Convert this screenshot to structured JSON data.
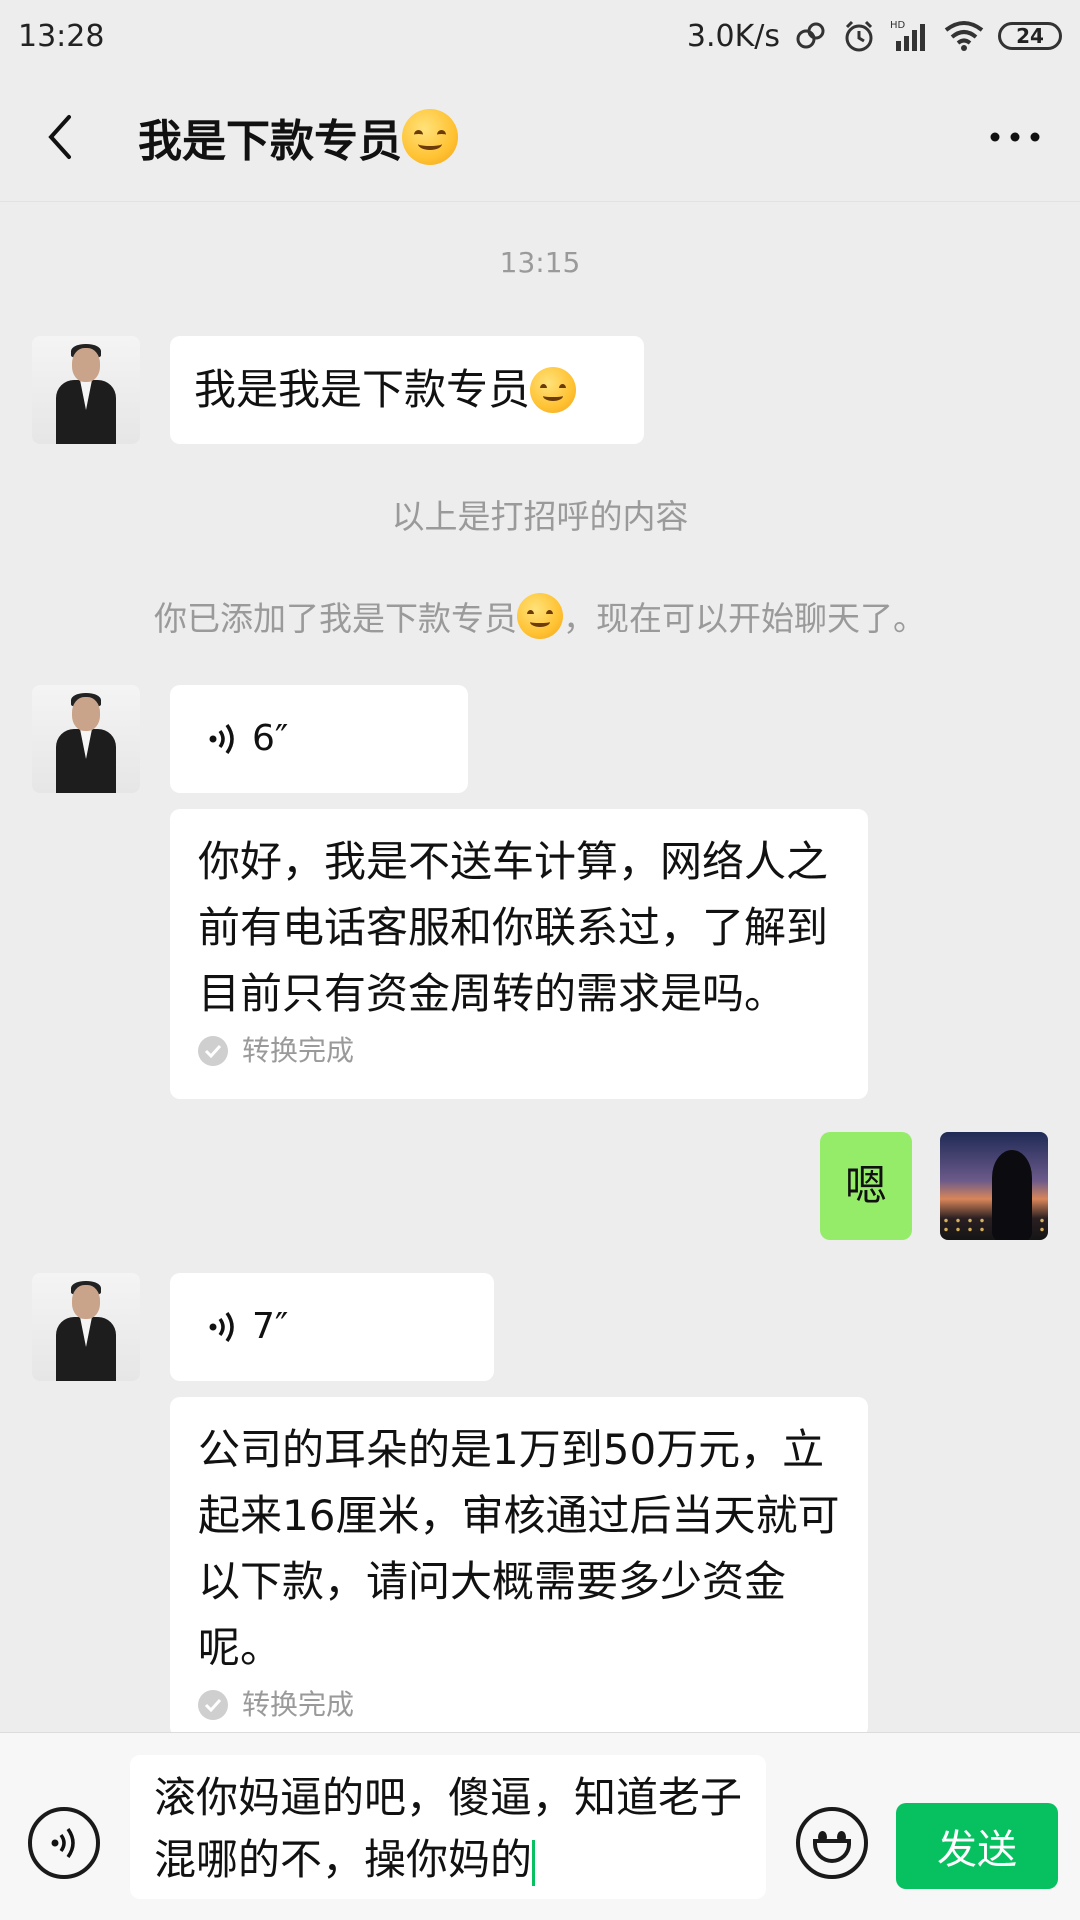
{
  "status_bar": {
    "time": "13:28",
    "net_speed": "3.0K/s",
    "battery": "24",
    "hd_label": "HD"
  },
  "header": {
    "title": "我是下款专员"
  },
  "messages": {
    "timestamp": "13:15",
    "msg1": "我是我是下款专员",
    "sys1": "以上是打招呼的内容",
    "sys2_prefix": "你已添加了我是下款专员",
    "sys2_suffix": "，现在可以开始聊天了。",
    "voice1_duration": "6″",
    "transcript1": "你好，我是不送车计算，网络人之前有电话客服和你联系过，了解到目前只有资金周转的需求是吗。",
    "converted_label": "转换完成",
    "reply1": "嗯",
    "voice2_duration": "7″",
    "transcript2": "公司的耳朵的是1万到50万元，立起来16厘米，审核通过后当天就可以下款，请问大概需要多少资金呢。",
    "converted_label2": "转换完成"
  },
  "input": {
    "text": "滚你妈逼的吧，傻逼，知道老子混哪的不，操你妈的",
    "send_label": "发送"
  },
  "colors": {
    "accent": "#07c160",
    "bubble_sent": "#95ec69",
    "background": "#ededed"
  }
}
